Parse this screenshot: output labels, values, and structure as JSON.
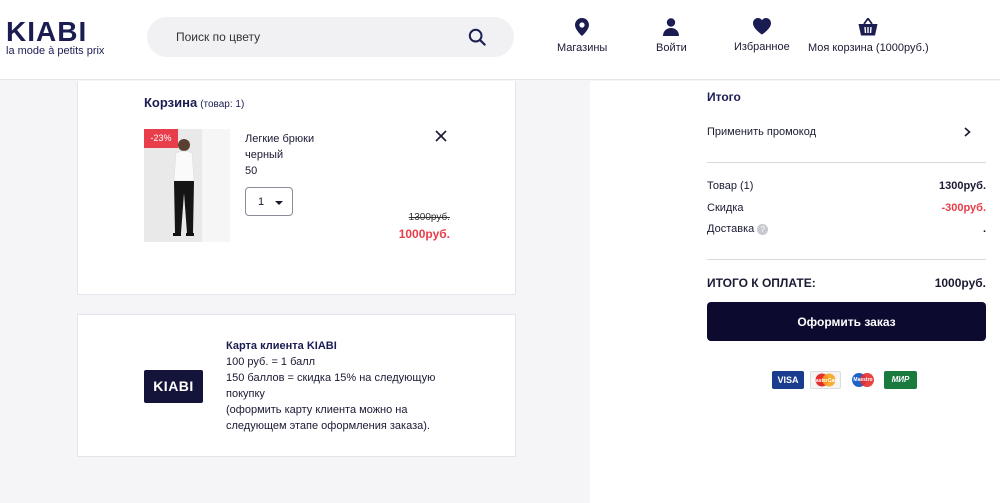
{
  "header": {
    "logo_main": "KIABI",
    "logo_sub": "la mode à petits prix",
    "search_placeholder": "Поиск по цвету",
    "nav": [
      {
        "label": "Магазины",
        "icon": "location-pin-icon"
      },
      {
        "label": "Войти",
        "icon": "user-icon"
      },
      {
        "label": "Избранное",
        "icon": "heart-icon"
      },
      {
        "label": "Моя корзина (1000руб.)",
        "icon": "basket-icon"
      }
    ]
  },
  "cart": {
    "title": "Корзина",
    "count": "(товар: 1)",
    "item": {
      "discount_badge": "-23%",
      "name": "Легкие брюки",
      "color": "черный",
      "size": "50",
      "quantity": "1",
      "old_price": "1300руб.",
      "new_price": "1000руб."
    }
  },
  "club": {
    "logo": "KIABI",
    "title": "Карта клиента KIABI",
    "lines": [
      "100 руб. = 1 балл",
      "150 баллов = скидка 15% на следующую покупку",
      "(оформить карту клиента можно на следующем этапе оформления заказа)."
    ]
  },
  "summary": {
    "title": "Итого",
    "promo_label": "Применить промокод",
    "rows": [
      {
        "label": "Товар (1)",
        "value": "1300руб.",
        "color": "#1a1a33"
      },
      {
        "label": "Скидка",
        "value": "-300руб.",
        "color": "#e83d4a"
      },
      {
        "label": "Доставка",
        "value": ".",
        "color": "#1a1a33"
      }
    ],
    "total_label": "ИТОГО К ОПЛАТЕ:",
    "total_value": "1000руб.",
    "checkout_label": "Оформить заказ",
    "payments": [
      "VISA",
      "MasterCard",
      "Maestro",
      "МИР"
    ]
  },
  "colors": {
    "brand": "#1b1d52",
    "accent_red": "#e83d4a",
    "button": "#0c0a2f"
  }
}
